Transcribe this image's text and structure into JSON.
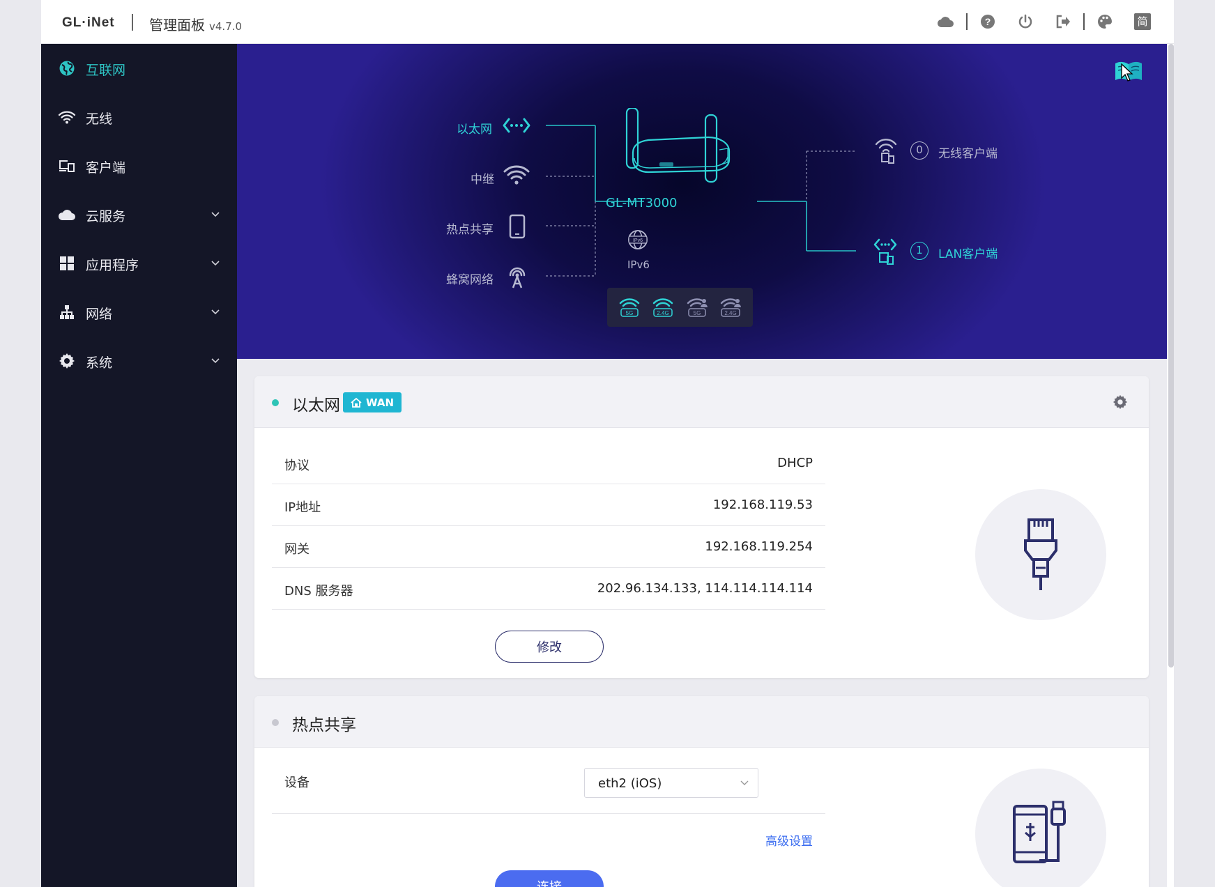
{
  "header": {
    "logo": "GL·iNet",
    "title": "管理面板",
    "version": "v4.7.0",
    "lang_button": "简",
    "icons": [
      "cloud-icon",
      "help-icon",
      "power-icon",
      "logout-icon",
      "palette-icon",
      "language-icon"
    ]
  },
  "sidebar": {
    "items": [
      {
        "label": "互联网",
        "icon": "globe-icon",
        "active": true,
        "expandable": false
      },
      {
        "label": "无线",
        "icon": "wifi-icon",
        "active": false,
        "expandable": false
      },
      {
        "label": "客户端",
        "icon": "devices-icon",
        "active": false,
        "expandable": false
      },
      {
        "label": "云服务",
        "icon": "cloud-icon",
        "active": false,
        "expandable": true
      },
      {
        "label": "应用程序",
        "icon": "apps-icon",
        "active": false,
        "expandable": true
      },
      {
        "label": "网络",
        "icon": "network-icon",
        "active": false,
        "expandable": true
      },
      {
        "label": "系统",
        "icon": "gear-icon",
        "active": false,
        "expandable": true
      }
    ]
  },
  "hero": {
    "uplinks": [
      {
        "label": "以太网",
        "icon": "ethernet-icon",
        "active": true
      },
      {
        "label": "中继",
        "icon": "wifi-icon",
        "active": false
      },
      {
        "label": "热点共享",
        "icon": "phone-icon",
        "active": false
      },
      {
        "label": "蜂窝网络",
        "icon": "cellular-icon",
        "active": false
      }
    ],
    "device_name": "GL-MT3000",
    "ipv6_label": "IPv6",
    "ipv6_badge": "IPv6",
    "wifi_bands": [
      "5G",
      "2.4G",
      "5G",
      "2.4G"
    ],
    "clients": [
      {
        "count": "0",
        "label": "无线客户端",
        "active": false
      },
      {
        "count": "1",
        "label": "LAN客户端",
        "active": true
      }
    ]
  },
  "ethernet_card": {
    "title": "以太网",
    "badge": "WAN",
    "status_color": "#2ec4b6",
    "rows": [
      {
        "key": "协议",
        "value": "DHCP"
      },
      {
        "key": "IP地址",
        "value": "192.168.119.53"
      },
      {
        "key": "网关",
        "value": "192.168.119.254"
      },
      {
        "key": "DNS 服务器",
        "value": "202.96.134.133, 114.114.114.114"
      }
    ],
    "modify_button": "修改"
  },
  "tethering_card": {
    "title": "热点共享",
    "status_color": "#c8c8d0",
    "device_label": "设备",
    "device_value": "eth2 (iOS)",
    "advanced_link": "高级设置",
    "connect_button": "连接"
  },
  "colors": {
    "accent": "#2fd3d6",
    "sidebar_bg": "#141627",
    "primary": "#4b6cf0",
    "wan_badge": "#1fb6d2"
  }
}
